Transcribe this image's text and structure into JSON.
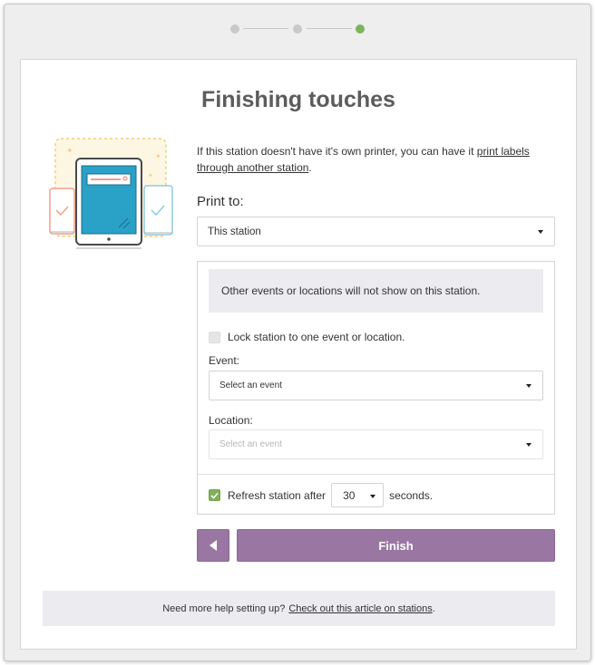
{
  "stepper": {
    "steps": [
      {
        "state": "completed",
        "color": "#c9c9c9"
      },
      {
        "state": "completed",
        "color": "#c9c9c9"
      },
      {
        "state": "current",
        "color": "#7ab55c"
      }
    ]
  },
  "page": {
    "title": "Finishing touches"
  },
  "intro": {
    "text_before": "If this station doesn't have it's own printer, you can have it ",
    "link": "print labels through another station",
    "text_after": "."
  },
  "print_to": {
    "label": "Print to:",
    "selected": "This station"
  },
  "restrictions": {
    "notice": "Other events or locations will not show on this station.",
    "lock_label": "Lock station to one event or location.",
    "lock_checked": false,
    "event_label": "Event:",
    "event_selected": "Select an event",
    "location_label": "Location:",
    "location_placeholder": "Select an event",
    "refresh_label": "Refresh station after",
    "refresh_checked": true,
    "refresh_value": "30",
    "refresh_unit": "seconds."
  },
  "actions": {
    "finish_label": "Finish"
  },
  "help": {
    "text": "Need more help setting up?",
    "link": "Check out this article on stations",
    "text_after": "."
  },
  "colors": {
    "accent": "#9a77a3",
    "success": "#7fb159",
    "notice_bg": "#ececf0"
  }
}
